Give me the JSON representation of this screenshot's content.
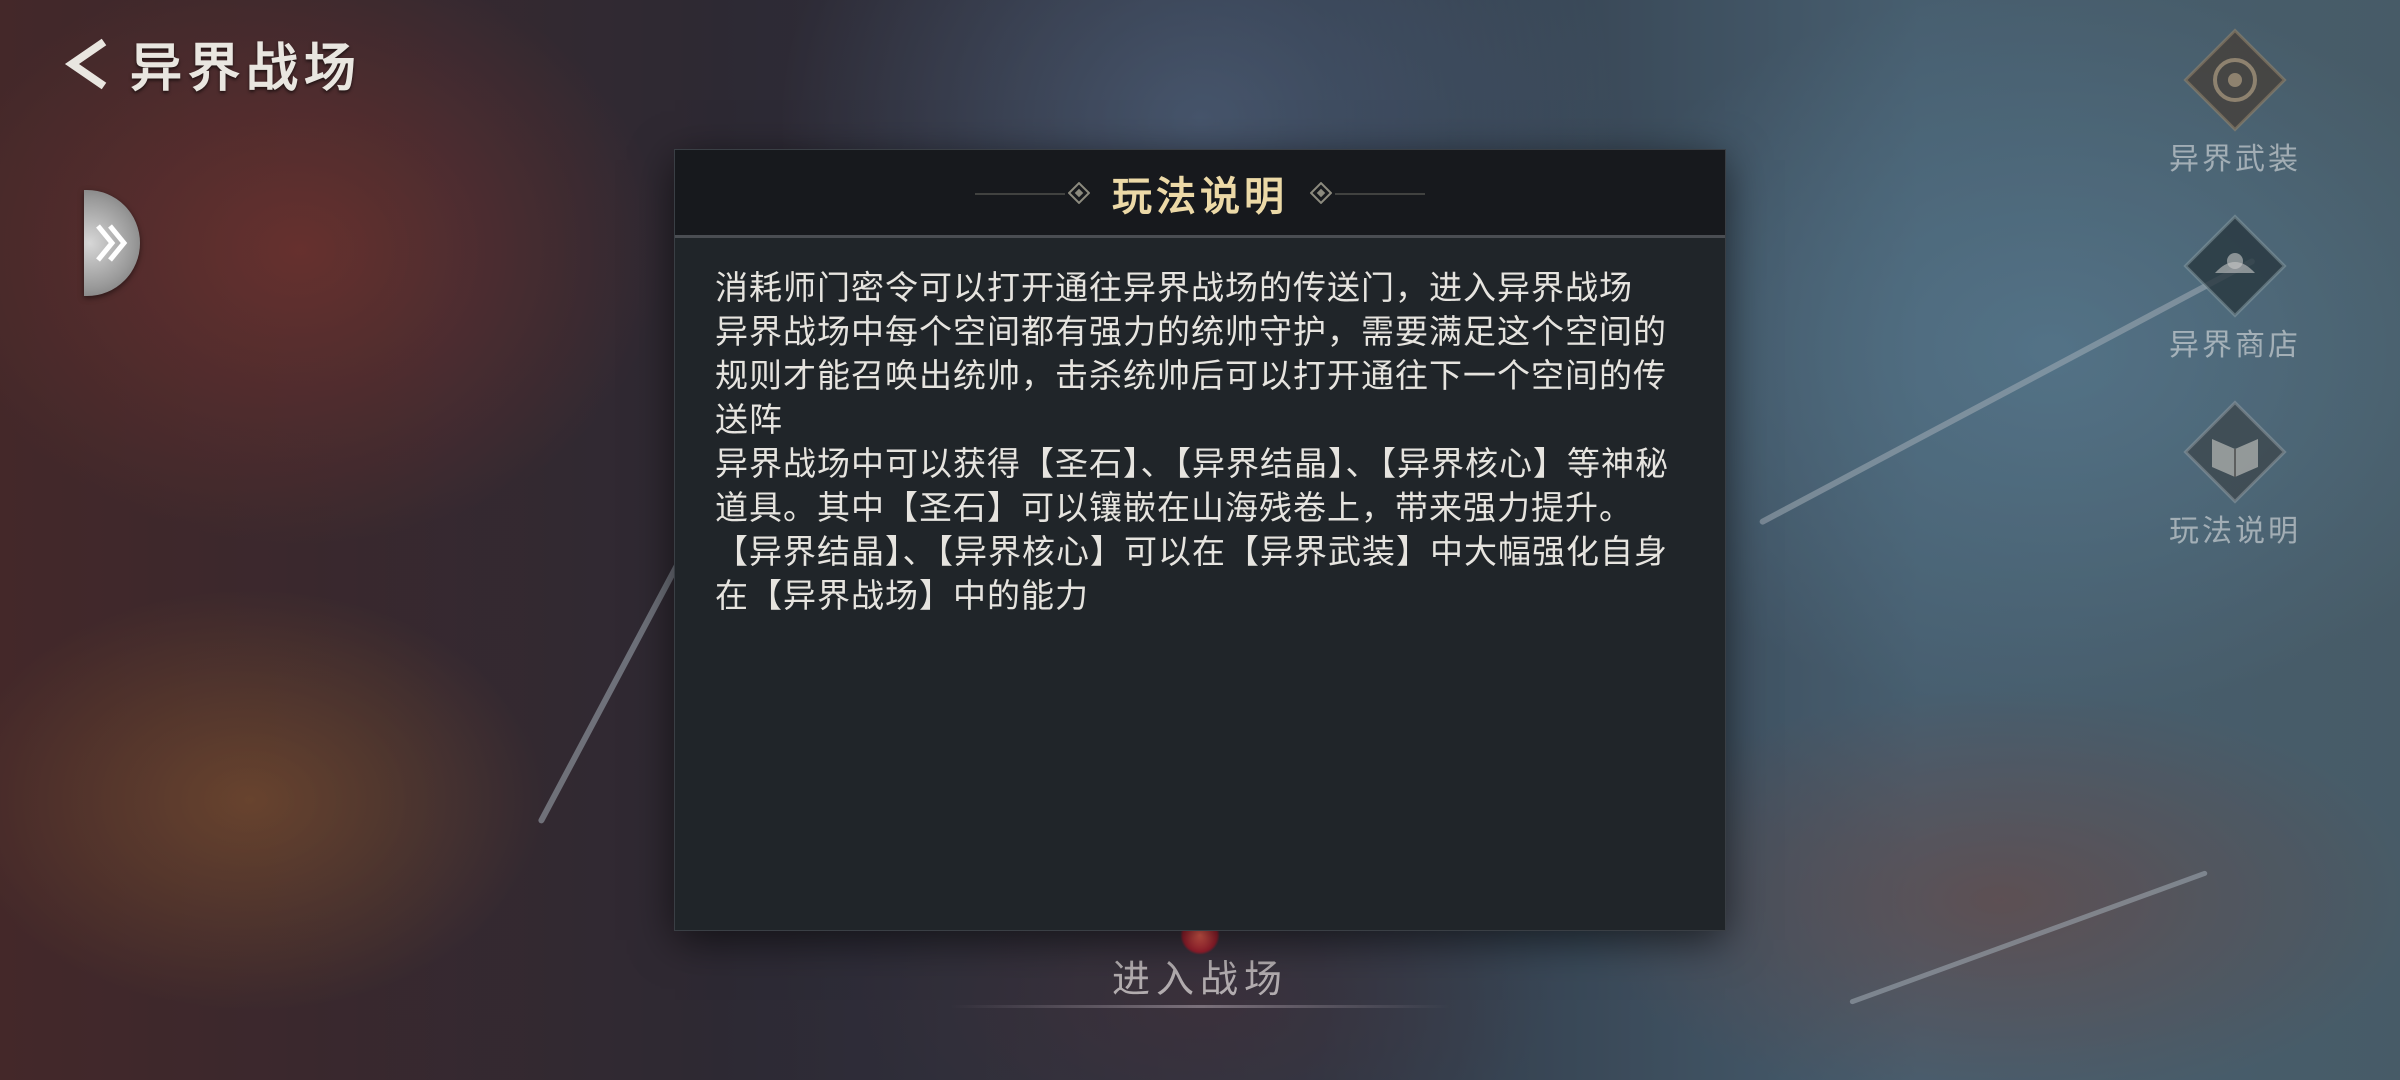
{
  "header": {
    "title": "异界战场"
  },
  "side_menu": {
    "items": [
      {
        "label": "异界武装",
        "icon": "armor-emblem-icon"
      },
      {
        "label": "异界商店",
        "icon": "shop-emblem-icon"
      },
      {
        "label": "玩法说明",
        "icon": "book-icon"
      }
    ]
  },
  "dialog": {
    "title": "玩法说明",
    "paragraphs": [
      "消耗师门密令可以打开通往异界战场的传送门，进入异界战场",
      "异界战场中每个空间都有强力的统帅守护，需要满足这个空间的规则才能召唤出统帅，击杀统帅后可以打开通往下一个空间的传送阵",
      "异界战场中可以获得【圣石】、【异界结晶】、【异界核心】等神秘道具。其中【圣石】可以镶嵌在山海残卷上，带来强力提升。【异界结晶】、【异界核心】可以在【异界武装】中大幅强化自身在【异界战场】中的能力"
    ]
  },
  "footer": {
    "enter_label": "进入战场"
  },
  "colors": {
    "dialog_bg": "#202529",
    "dialog_header_bg": "#17191d",
    "title_gold": "#ecd9a7",
    "body_text": "#e6e4df"
  }
}
